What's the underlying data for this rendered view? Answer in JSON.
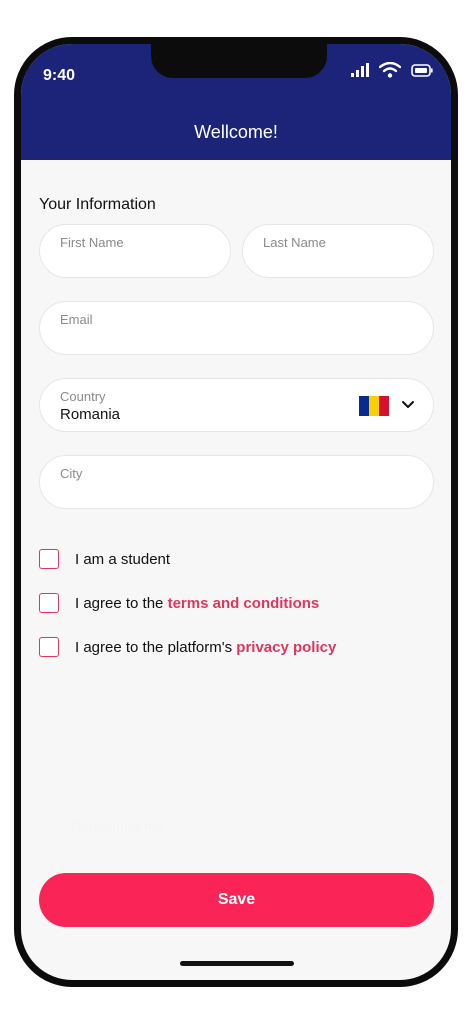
{
  "status_bar": {
    "time": "9:40"
  },
  "header": {
    "title": "Wellcome!"
  },
  "form": {
    "section_title": "Your Information",
    "first_name_placeholder": "First Name",
    "last_name_placeholder": "Last Name",
    "email_placeholder": "Email",
    "country_label": "Country",
    "country_value": "Romania",
    "city_placeholder": "City"
  },
  "checkboxes": [
    {
      "text": "I am a student",
      "link": ""
    },
    {
      "text": "I agree to the ",
      "link": "terms and conditions"
    },
    {
      "text": "I agree to the platform's ",
      "link": "privacy policy"
    }
  ],
  "faded_text": "Remember me",
  "save_label": "Save",
  "colors": {
    "header": "#1b2479",
    "accent": "#fb2456",
    "link": "#e0365d"
  },
  "icons": [
    "cellular-signal-icon",
    "wifi-icon",
    "battery-icon",
    "romania-flag-icon",
    "chevron-down-icon"
  ]
}
